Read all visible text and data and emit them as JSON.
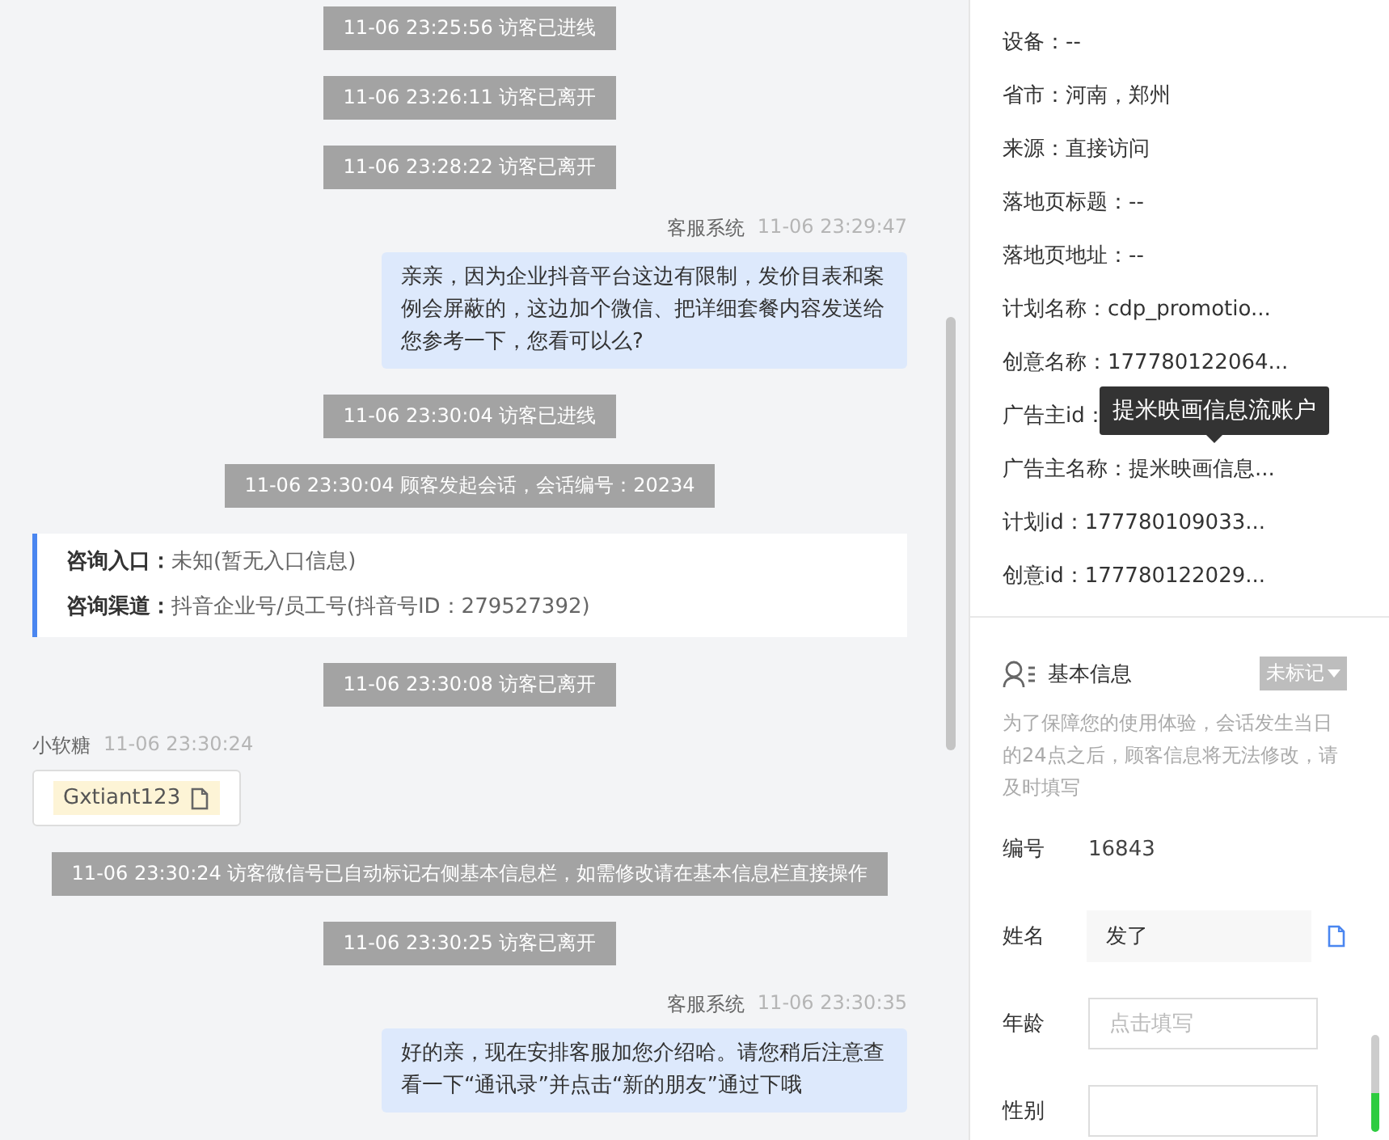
{
  "chat": {
    "items": [
      {
        "kind": "system",
        "text": "11-06 23:25:56 访客已进线"
      },
      {
        "kind": "system",
        "text": "11-06 23:26:11 访客已离开"
      },
      {
        "kind": "system",
        "text": "11-06 23:28:22 访客已离开"
      },
      {
        "kind": "agent",
        "sender": "客服系统",
        "time": "11-06 23:29:47",
        "text": "亲亲，因为企业抖音平台这边有限制，发价目表和案例会屏蔽的，这边加个微信、把详细套餐内容发送给您参考一下，您看可以么?"
      },
      {
        "kind": "system",
        "text": "11-06 23:30:04 访客已进线"
      },
      {
        "kind": "system",
        "text": "11-06 23:30:04 顾客发起会话，会话编号：20234"
      },
      {
        "kind": "info",
        "rows": [
          {
            "label": "咨询入口：",
            "value": "未知(暂无入口信息)"
          },
          {
            "label": "咨询渠道：",
            "value": "抖音企业号/员工号(抖音号ID：279527392)"
          }
        ]
      },
      {
        "kind": "system",
        "text": "11-06 23:30:08 访客已离开"
      },
      {
        "kind": "visitor",
        "sender": "小软糖",
        "time": "11-06 23:30:24",
        "chip": "Gxtiant123"
      },
      {
        "kind": "system",
        "text": "11-06 23:30:24 访客微信号已自动标记右侧基本信息栏，如需修改请在基本信息栏直接操作"
      },
      {
        "kind": "system",
        "text": "11-06 23:30:25 访客已离开"
      },
      {
        "kind": "agent",
        "sender": "客服系统",
        "time": "11-06 23:30:35",
        "text": "好的亲，现在安排客服加您介绍哈。请您稍后注意查看一下“通讯录”并点击“新的朋友”通过下哦"
      }
    ]
  },
  "details": {
    "rows": [
      {
        "text": "设备：--"
      },
      {
        "text": "省市：河南，郑州"
      },
      {
        "text": "来源：直接访问"
      },
      {
        "text": "落地页标题：--"
      },
      {
        "text": "落地页地址：--"
      },
      {
        "text": "计划名称：cdp_promotio..."
      },
      {
        "text": "创意名称：177780122064..."
      },
      {
        "text": "广告主id："
      },
      {
        "text": "广告主名称：提米映画信息...",
        "tooltip": "提米映画信息流账户"
      },
      {
        "text": "计划id：177780109033..."
      },
      {
        "text": "创意id：177780122029..."
      }
    ]
  },
  "basic_info": {
    "title": "基本信息",
    "tag": "未标记",
    "note": "为了保障您的使用体验，会话发生当日的24点之后，顾客信息将无法修改，请及时填写",
    "fields": [
      {
        "kind": "text",
        "label": "编号",
        "value": "16843"
      },
      {
        "kind": "filled",
        "label": "姓名",
        "value": "发了"
      },
      {
        "kind": "input",
        "label": "年龄",
        "placeholder": "点击填写"
      },
      {
        "kind": "input",
        "label": "性别"
      }
    ]
  }
}
